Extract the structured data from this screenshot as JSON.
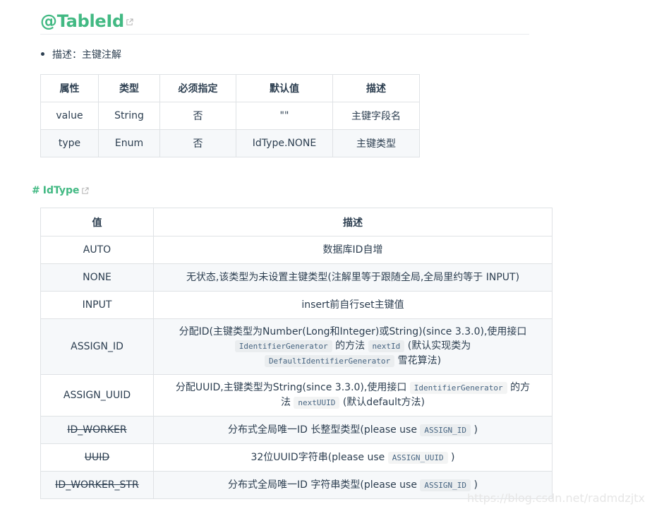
{
  "title": "@TableId",
  "description_line": "描述：主键注解",
  "table1": {
    "headers": [
      "属性",
      "类型",
      "必须指定",
      "默认值",
      "描述"
    ],
    "rows": [
      [
        "value",
        "String",
        "否",
        "\"\"",
        "主键字段名"
      ],
      [
        "type",
        "Enum",
        "否",
        "IdType.NONE",
        "主键类型"
      ]
    ]
  },
  "section2": {
    "hash": "#",
    "title": "IdType"
  },
  "table2": {
    "headers": [
      "值",
      "描述"
    ],
    "rows": [
      {
        "value": "AUTO",
        "desc": [
          {
            "t": "数据库ID自增"
          }
        ],
        "deprecated": false
      },
      {
        "value": "NONE",
        "desc": [
          {
            "t": "无状态,该类型为未设置主键类型(注解里等于跟随全局,全局里约等于 INPUT)"
          }
        ],
        "deprecated": false
      },
      {
        "value": "INPUT",
        "desc": [
          {
            "t": "insert前自行set主键值"
          }
        ],
        "deprecated": false
      },
      {
        "value": "ASSIGN_ID",
        "desc": [
          {
            "t": "分配ID(主键类型为Number(Long和Integer)或String)(since 3.3.0),使用接口"
          },
          {
            "br": true
          },
          {
            "code": "IdentifierGenerator"
          },
          {
            "t": " 的方法 "
          },
          {
            "code": "nextId"
          },
          {
            "t": " (默认实现类为"
          },
          {
            "br": true
          },
          {
            "code": "DefaultIdentifierGenerator"
          },
          {
            "t": " 雪花算法)"
          }
        ],
        "deprecated": false
      },
      {
        "value": "ASSIGN_UUID",
        "desc": [
          {
            "t": "分配UUID,主键类型为String(since 3.3.0),使用接口 "
          },
          {
            "code": "IdentifierGenerator"
          },
          {
            "t": " 的方"
          },
          {
            "br": true
          },
          {
            "t": "法 "
          },
          {
            "code": "nextUUID"
          },
          {
            "t": " (默认default方法)"
          }
        ],
        "deprecated": false
      },
      {
        "value": "ID_WORKER",
        "desc": [
          {
            "t": "分布式全局唯一ID 长整型类型(please use "
          },
          {
            "code": "ASSIGN_ID"
          },
          {
            "t": " )"
          }
        ],
        "deprecated": true
      },
      {
        "value": "UUID",
        "desc": [
          {
            "t": "32位UUID字符串(please use "
          },
          {
            "code": "ASSIGN_UUID"
          },
          {
            "t": " )"
          }
        ],
        "deprecated": true
      },
      {
        "value": "ID_WORKER_STR",
        "desc": [
          {
            "t": "分布式全局唯一ID 字符串类型(please use "
          },
          {
            "code": "ASSIGN_ID"
          },
          {
            "t": " )"
          }
        ],
        "deprecated": true
      }
    ]
  },
  "watermark": "https://blog.csdn.net/radmdzjtx",
  "colors": {
    "accent": "#42b983",
    "text": "#2c3e50",
    "border": "#dfe2e5",
    "stripe": "#f6f8fa",
    "code_text": "#476582"
  }
}
